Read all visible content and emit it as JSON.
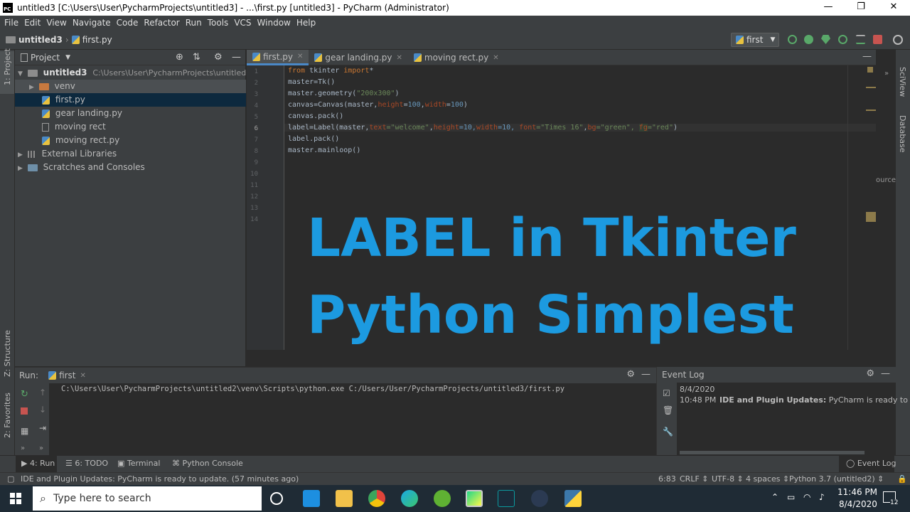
{
  "window": {
    "title": "untitled3 [C:\\Users\\User\\PycharmProjects\\untitled3] - ...\\first.py [untitled3] - PyCharm (Administrator)",
    "minimize": "—",
    "maximize": "❐",
    "close": "✕"
  },
  "menu": [
    "File",
    "Edit",
    "View",
    "Navigate",
    "Code",
    "Refactor",
    "Run",
    "Tools",
    "VCS",
    "Window",
    "Help"
  ],
  "breadcrumb": {
    "project": "untitled3",
    "file": "first.py"
  },
  "run_config": {
    "label": "first"
  },
  "project_panel": {
    "title": "Project",
    "root_name": "untitled3",
    "root_path": "C:\\Users\\User\\PycharmProjects\\untitled3",
    "items": [
      "venv",
      "first.py",
      "gear landing.py",
      "moving rect",
      "moving rect.py"
    ],
    "external": "External Libraries",
    "scratches": "Scratches and Consoles"
  },
  "left_strip": {
    "project": "1: Project",
    "structure": "Z: Structure",
    "favorites": "2: Favorites"
  },
  "right_strip": {
    "sciview": "SciView",
    "database": "Database",
    "partial": "ource"
  },
  "tabs": [
    "first.py",
    "gear landing.py",
    "moving rect.py"
  ],
  "editor": {
    "line_numbers": [
      "1",
      "2",
      "3",
      "4",
      "5",
      "6",
      "7",
      "8",
      "9",
      "10",
      "11",
      "12",
      "13",
      "14"
    ],
    "code": {
      "l1_kw1": "from",
      "l1_mod": " tkinter ",
      "l1_kw2": "import",
      "l1_star": "*",
      "l2": "master=Tk()",
      "l3_a": "master.geometry(",
      "l3_s": "\"200x300\"",
      "l3_b": ")",
      "l4_a": "canvas=Canvas(master,",
      "l4_p1": "height",
      "l4_eq1": "=",
      "l4_n1": "100",
      "l4_c": ",",
      "l4_p2": "width",
      "l4_eq2": "=",
      "l4_n2": "100",
      "l4_b": ")",
      "l5": "canvas.pack()",
      "l6_a": "label=Label(master,",
      "l6_p1": "text",
      "l6_s1": "=\"welcome\"",
      "l6_c1": ",",
      "l6_p2": "height",
      "l6_n1": "=10,",
      "l6_p3": "width",
      "l6_n2": "=10, ",
      "l6_p4": "font",
      "l6_s2": "=\"Times 16\"",
      "l6_c2": ",",
      "l6_p5": "bg",
      "l6_s3": "=\"green\", ",
      "l6_p6": "fg",
      "l6_s4": "=\"red\"",
      "l6_b": ")",
      "l7": "label.pack()",
      "l8": "master.mainloop()"
    },
    "overlay_line1": "LABEL in Tkinter",
    "overlay_line2": "Python Simplest"
  },
  "run_panel": {
    "title": "Run:",
    "tab": "first",
    "output": "C:\\Users\\User\\PycharmProjects\\untitled2\\venv\\Scripts\\python.exe C:/Users/User/PycharmProjects/untitled3/first.py"
  },
  "event_log": {
    "title": "Event Log",
    "date": "8/4/2020",
    "time": "10:48 PM",
    "bold": "IDE and Plugin Updates:",
    "message": " PyCharm is ready to ",
    "link": "upda"
  },
  "tool_tabs": {
    "run": "4: Run",
    "todo": "6: TODO",
    "terminal": "Terminal",
    "python_console": "Python Console",
    "event_log": "Event Log"
  },
  "status_bar": {
    "message": "IDE and Plugin Updates: PyCharm is ready to update. (57 minutes ago)",
    "position": "6:83",
    "line_sep": "CRLF ⇕",
    "encoding": "UTF-8 ⇕",
    "indent": "4 spaces ⇕",
    "interpreter": "Python 3.7 (untitled2) ⇕"
  },
  "taskbar": {
    "search_placeholder": "Type here to search",
    "time": "11:46 PM",
    "date": "8/4/2020",
    "notifications": "12"
  },
  "colors": {
    "overlay_text": "#1c9ae0",
    "keyword": "#cc7832",
    "string": "#6a8759",
    "number": "#6897bb",
    "param": "#aa4926"
  }
}
